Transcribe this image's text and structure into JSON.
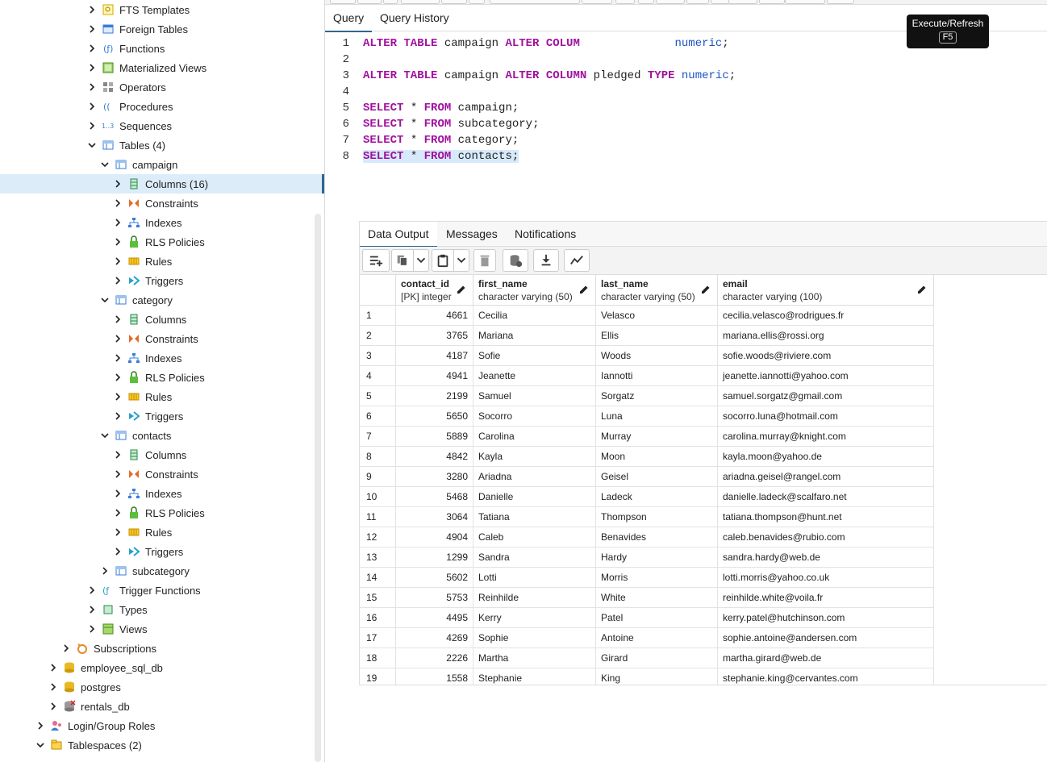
{
  "tree": {
    "items": [
      {
        "label": "FTS Templates",
        "depth": 6,
        "open": false,
        "icon": "fts-template-icon"
      },
      {
        "label": "Foreign Tables",
        "depth": 6,
        "open": false,
        "icon": "foreign-table-icon"
      },
      {
        "label": "Functions",
        "depth": 6,
        "open": false,
        "icon": "function-icon"
      },
      {
        "label": "Materialized Views",
        "depth": 6,
        "open": false,
        "icon": "materialized-view-icon"
      },
      {
        "label": "Operators",
        "depth": 6,
        "open": false,
        "icon": "operator-icon"
      },
      {
        "label": "Procedures",
        "depth": 6,
        "open": false,
        "icon": "procedure-icon"
      },
      {
        "label": "Sequences",
        "depth": 6,
        "open": false,
        "icon": "sequence-icon"
      },
      {
        "label": "Tables (4)",
        "depth": 6,
        "open": true,
        "icon": "table-icon"
      },
      {
        "label": "campaign",
        "depth": 7,
        "open": true,
        "icon": "table-icon"
      },
      {
        "label": "Columns (16)",
        "depth": 8,
        "open": false,
        "icon": "columns-icon",
        "selected": true
      },
      {
        "label": "Constraints",
        "depth": 8,
        "open": false,
        "icon": "constraint-icon"
      },
      {
        "label": "Indexes",
        "depth": 8,
        "open": false,
        "icon": "index-icon"
      },
      {
        "label": "RLS Policies",
        "depth": 8,
        "open": false,
        "icon": "rls-policy-icon"
      },
      {
        "label": "Rules",
        "depth": 8,
        "open": false,
        "icon": "rule-icon"
      },
      {
        "label": "Triggers",
        "depth": 8,
        "open": false,
        "icon": "trigger-icon"
      },
      {
        "label": "category",
        "depth": 7,
        "open": true,
        "icon": "table-icon"
      },
      {
        "label": "Columns",
        "depth": 8,
        "open": false,
        "icon": "columns-icon"
      },
      {
        "label": "Constraints",
        "depth": 8,
        "open": false,
        "icon": "constraint-icon"
      },
      {
        "label": "Indexes",
        "depth": 8,
        "open": false,
        "icon": "index-icon"
      },
      {
        "label": "RLS Policies",
        "depth": 8,
        "open": false,
        "icon": "rls-policy-icon"
      },
      {
        "label": "Rules",
        "depth": 8,
        "open": false,
        "icon": "rule-icon"
      },
      {
        "label": "Triggers",
        "depth": 8,
        "open": false,
        "icon": "trigger-icon"
      },
      {
        "label": "contacts",
        "depth": 7,
        "open": true,
        "icon": "table-icon"
      },
      {
        "label": "Columns",
        "depth": 8,
        "open": false,
        "icon": "columns-icon"
      },
      {
        "label": "Constraints",
        "depth": 8,
        "open": false,
        "icon": "constraint-icon"
      },
      {
        "label": "Indexes",
        "depth": 8,
        "open": false,
        "icon": "index-icon"
      },
      {
        "label": "RLS Policies",
        "depth": 8,
        "open": false,
        "icon": "rls-policy-icon"
      },
      {
        "label": "Rules",
        "depth": 8,
        "open": false,
        "icon": "rule-icon"
      },
      {
        "label": "Triggers",
        "depth": 8,
        "open": false,
        "icon": "trigger-icon"
      },
      {
        "label": "subcategory",
        "depth": 7,
        "open": false,
        "icon": "table-icon"
      },
      {
        "label": "Trigger Functions",
        "depth": 6,
        "open": false,
        "icon": "trigger-function-icon"
      },
      {
        "label": "Types",
        "depth": 6,
        "open": false,
        "icon": "type-icon"
      },
      {
        "label": "Views",
        "depth": 6,
        "open": false,
        "icon": "view-icon"
      },
      {
        "label": "Subscriptions",
        "depth": 4,
        "open": false,
        "icon": "subscription-icon"
      },
      {
        "label": "employee_sql_db",
        "depth": 3,
        "open": false,
        "icon": "database-icon"
      },
      {
        "label": "postgres",
        "depth": 3,
        "open": false,
        "icon": "database-icon"
      },
      {
        "label": "rentals_db",
        "depth": 3,
        "open": false,
        "icon": "database-disconnected-icon"
      },
      {
        "label": "Login/Group Roles",
        "depth": 2,
        "open": false,
        "icon": "login-role-icon"
      },
      {
        "label": "Tablespaces (2)",
        "depth": 2,
        "open": true,
        "icon": "tablespace-icon"
      }
    ]
  },
  "query_tabs": [
    {
      "label": "Query",
      "active": true
    },
    {
      "label": "Query History",
      "active": false
    }
  ],
  "tooltip": {
    "title": "Execute/Refresh",
    "key": "F5"
  },
  "editor": {
    "lines": [
      {
        "n": "1",
        "tokens": [
          {
            "t": "ALTER TABLE",
            "k": "kw"
          },
          {
            "t": " campaign ",
            "k": ""
          },
          {
            "t": "ALTER COLUM",
            "k": "kw"
          },
          {
            "t": "              ",
            "k": ""
          },
          {
            "t": "numeric",
            "k": "ty"
          },
          {
            "t": ";",
            "k": ""
          }
        ]
      },
      {
        "n": "2",
        "tokens": []
      },
      {
        "n": "3",
        "tokens": [
          {
            "t": "ALTER TABLE",
            "k": "kw"
          },
          {
            "t": " campaign ",
            "k": ""
          },
          {
            "t": "ALTER COLUMN",
            "k": "kw"
          },
          {
            "t": " pledged ",
            "k": ""
          },
          {
            "t": "TYPE",
            "k": "kw"
          },
          {
            "t": " ",
            "k": ""
          },
          {
            "t": "numeric",
            "k": "ty"
          },
          {
            "t": ";",
            "k": ""
          }
        ]
      },
      {
        "n": "4",
        "tokens": []
      },
      {
        "n": "5",
        "tokens": [
          {
            "t": "SELECT",
            "k": "kw"
          },
          {
            "t": " * ",
            "k": ""
          },
          {
            "t": "FROM",
            "k": "kw"
          },
          {
            "t": " campaign;",
            "k": ""
          }
        ]
      },
      {
        "n": "6",
        "tokens": [
          {
            "t": "SELECT",
            "k": "kw"
          },
          {
            "t": " * ",
            "k": ""
          },
          {
            "t": "FROM",
            "k": "kw"
          },
          {
            "t": " subcategory;",
            "k": ""
          }
        ]
      },
      {
        "n": "7",
        "tokens": [
          {
            "t": "SELECT",
            "k": "kw"
          },
          {
            "t": " * ",
            "k": ""
          },
          {
            "t": "FROM",
            "k": "kw"
          },
          {
            "t": " category;",
            "k": ""
          }
        ]
      },
      {
        "n": "8",
        "tokens": [
          {
            "t": "SELECT",
            "k": "kw"
          },
          {
            "t": " * ",
            "k": ""
          },
          {
            "t": "FROM",
            "k": "kw"
          },
          {
            "t": " contacts;",
            "k": ""
          }
        ],
        "highlight": true
      }
    ]
  },
  "result_tabs": [
    {
      "label": "Data Output",
      "active": true
    },
    {
      "label": "Messages",
      "active": false
    },
    {
      "label": "Notifications",
      "active": false
    }
  ],
  "result_tools": [
    {
      "name": "add-row-icon"
    },
    {
      "name": "copy-icon"
    },
    {
      "name": "chevron-down-icon"
    },
    {
      "name": "paste-icon"
    },
    {
      "name": "chevron-down-icon"
    },
    {
      "name": "delete-icon"
    },
    {
      "name": "save-data-icon"
    },
    {
      "name": "download-icon"
    },
    {
      "name": "graph-icon"
    }
  ],
  "columns": [
    {
      "name": "contact_id",
      "type": "[PK] integer"
    },
    {
      "name": "first_name",
      "type": "character varying (50)"
    },
    {
      "name": "last_name",
      "type": "character varying (50)"
    },
    {
      "name": "email",
      "type": "character varying (100)"
    }
  ],
  "rows": [
    [
      "1",
      "4661",
      "Cecilia",
      "Velasco",
      "cecilia.velasco@rodrigues.fr"
    ],
    [
      "2",
      "3765",
      "Mariana",
      "Ellis",
      "mariana.ellis@rossi.org"
    ],
    [
      "3",
      "4187",
      "Sofie",
      "Woods",
      "sofie.woods@riviere.com"
    ],
    [
      "4",
      "4941",
      "Jeanette",
      "Iannotti",
      "jeanette.iannotti@yahoo.com"
    ],
    [
      "5",
      "2199",
      "Samuel",
      "Sorgatz",
      "samuel.sorgatz@gmail.com"
    ],
    [
      "6",
      "5650",
      "Socorro",
      "Luna",
      "socorro.luna@hotmail.com"
    ],
    [
      "7",
      "5889",
      "Carolina",
      "Murray",
      "carolina.murray@knight.com"
    ],
    [
      "8",
      "4842",
      "Kayla",
      "Moon",
      "kayla.moon@yahoo.de"
    ],
    [
      "9",
      "3280",
      "Ariadna",
      "Geisel",
      "ariadna.geisel@rangel.com"
    ],
    [
      "10",
      "5468",
      "Danielle",
      "Ladeck",
      "danielle.ladeck@scalfaro.net"
    ],
    [
      "11",
      "3064",
      "Tatiana",
      "Thompson",
      "tatiana.thompson@hunt.net"
    ],
    [
      "12",
      "4904",
      "Caleb",
      "Benavides",
      "caleb.benavides@rubio.com"
    ],
    [
      "13",
      "1299",
      "Sandra",
      "Hardy",
      "sandra.hardy@web.de"
    ],
    [
      "14",
      "5602",
      "Lotti",
      "Morris",
      "lotti.morris@yahoo.co.uk"
    ],
    [
      "15",
      "5753",
      "Reinhilde",
      "White",
      "reinhilde.white@voila.fr"
    ],
    [
      "16",
      "4495",
      "Kerry",
      "Patel",
      "kerry.patel@hutchinson.com"
    ],
    [
      "17",
      "4269",
      "Sophie",
      "Antoine",
      "sophie.antoine@andersen.com"
    ],
    [
      "18",
      "2226",
      "Martha",
      "Girard",
      "martha.girard@web.de"
    ],
    [
      "19",
      "1558",
      "Stephanie",
      "King",
      "stephanie.king@cervantes.com"
    ]
  ]
}
